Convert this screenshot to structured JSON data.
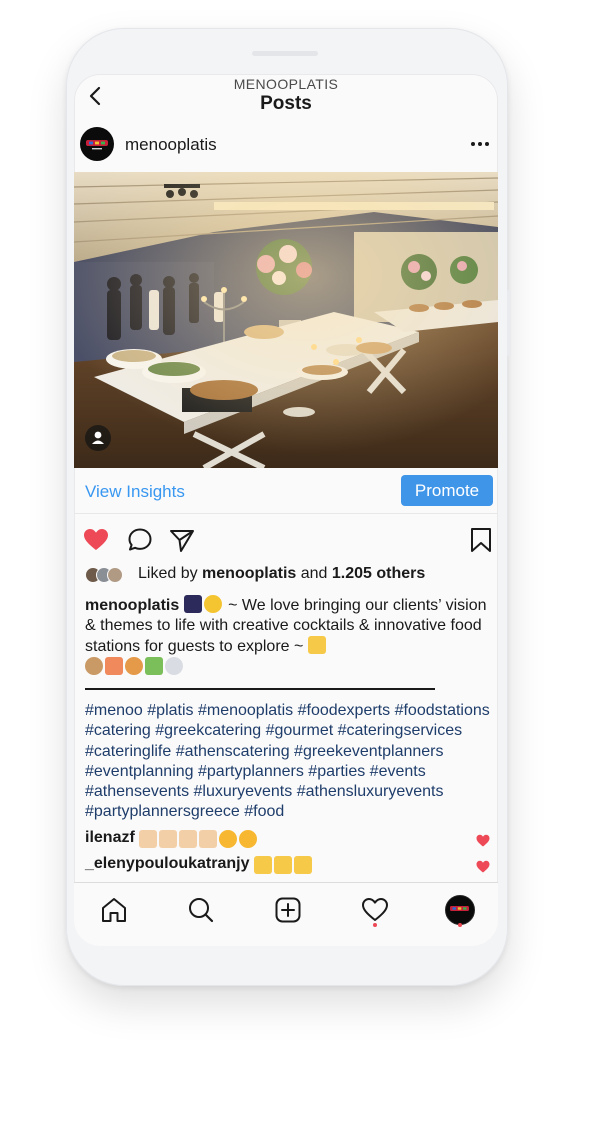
{
  "header": {
    "account": "MENOOPLATIS",
    "title": "Posts"
  },
  "post": {
    "username": "menooplatis",
    "avatar_text": "menoo",
    "view_insights_label": "View Insights",
    "promote_label": "Promote",
    "liked_prefix": "Liked by",
    "liked_user": "menooplatis",
    "liked_and": "and",
    "liked_others": "1.205 others",
    "caption_user": "menooplatis",
    "caption_text": "~ We love bringing our clients’ vision & themes to life with creative cocktails & innovative food stations for guests to explore ~",
    "hashtags": [
      "#menoo",
      "#platis",
      "#menooplatis",
      "#foodexperts",
      "#foodstations",
      "#catering",
      "#greekcatering",
      "#gourmet",
      "#cateringservices",
      "#cateringlife",
      "#athenscatering",
      "#greekeventplanners",
      "#eventplanning",
      "#partyplanners",
      "#parties",
      "#events",
      "#athensevents",
      "#luxuryevents",
      "#athensluxuryevents",
      "#partyplannersgreece",
      "#food"
    ],
    "comments": [
      {
        "user": "ilenazf"
      },
      {
        "user": "_elenypouloukatranjy"
      }
    ]
  },
  "colors": {
    "link_blue": "#3897f0",
    "promote_bg": "#3f95e8",
    "like_red": "#ed4956",
    "hashtag": "#1f3d6b"
  },
  "icons": {
    "back": "chevron-left-icon",
    "more": "more-horizontal-icon",
    "like": "heart-filled-icon",
    "comment": "comment-bubble-icon",
    "share": "paper-plane-icon",
    "save": "bookmark-icon",
    "tag": "user-tag-icon",
    "tabs": [
      "home-icon",
      "search-icon",
      "add-post-icon",
      "activity-heart-icon",
      "profile-avatar-icon"
    ]
  }
}
